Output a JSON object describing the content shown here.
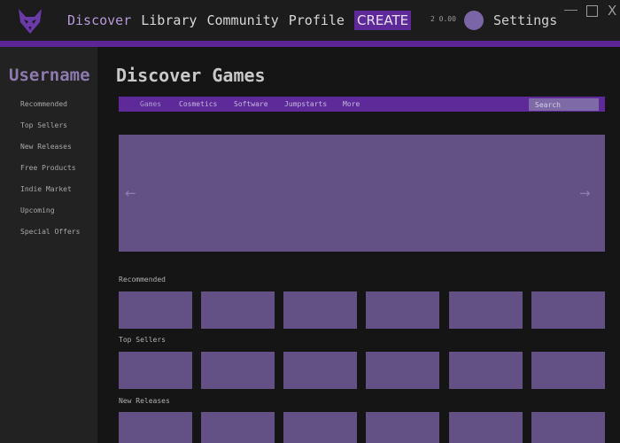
{
  "app": {
    "logo_icon": "fox-logo-icon",
    "accent_color": "#5e2a9a",
    "tile_color": "#635186"
  },
  "nav": {
    "items": [
      {
        "label": "Discover",
        "active": true
      },
      {
        "label": "Library"
      },
      {
        "label": "Community"
      },
      {
        "label": "Profile"
      }
    ],
    "create_label": "CREATE",
    "coins": "2 0.00",
    "avatar_icon": "user-avatar-icon",
    "settings_label": "Settings"
  },
  "window_controls": {
    "minimize_icon": "minimize-icon",
    "maximize_icon": "maximize-icon",
    "close_label": "X"
  },
  "sidebar": {
    "username": "Username",
    "items": [
      {
        "label": "Recommended"
      },
      {
        "label": "Top Sellers"
      },
      {
        "label": "New Releases"
      },
      {
        "label": "Free Products"
      },
      {
        "label": "Indie Market"
      },
      {
        "label": "Upcoming"
      },
      {
        "label": "Special Offers"
      }
    ]
  },
  "main": {
    "title": "Discover Games",
    "tabs": [
      {
        "label": "Games",
        "active": true
      },
      {
        "label": "Cosmetics"
      },
      {
        "label": "Software"
      },
      {
        "label": "Jumpstarts"
      },
      {
        "label": "More"
      }
    ],
    "search_placeholder": "Search",
    "carousel": {
      "prev_icon": "arrow-left-icon",
      "next_icon": "arrow-right-icon"
    },
    "sections": [
      {
        "title": "Recommended",
        "tile_count": 6
      },
      {
        "title": "Top Sellers",
        "tile_count": 6
      },
      {
        "title": "New Releases",
        "tile_count": 6
      }
    ]
  }
}
